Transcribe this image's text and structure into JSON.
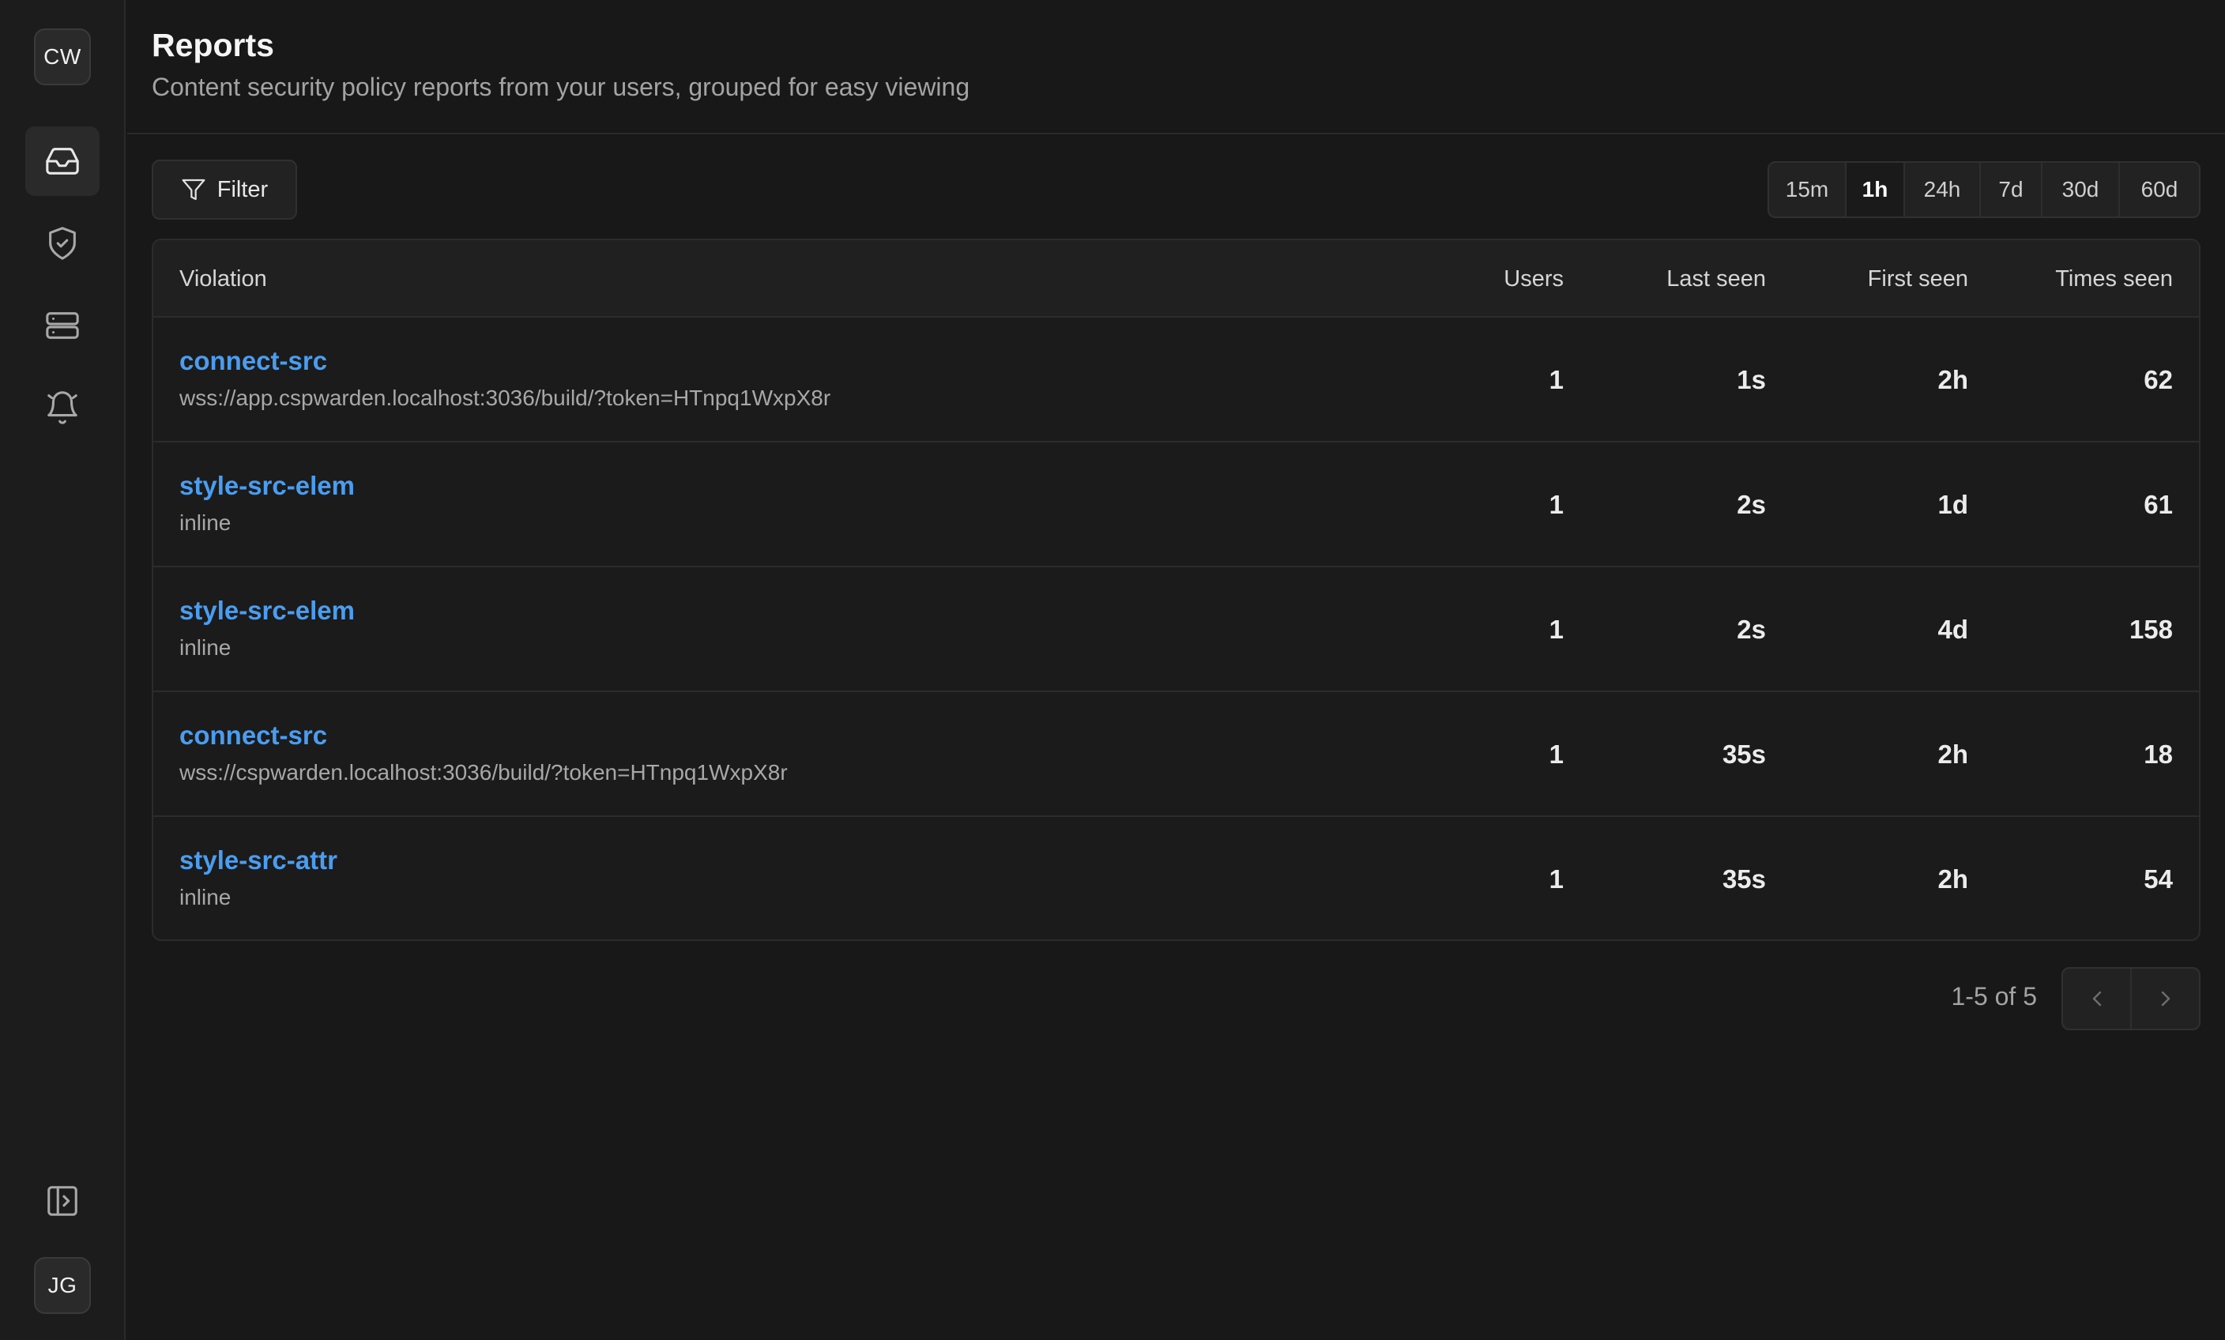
{
  "sidebar": {
    "workspace_badge": "CW",
    "user_badge": "JG",
    "nav": [
      {
        "icon": "inbox-icon",
        "active": true
      },
      {
        "icon": "shield-check-icon",
        "active": false
      },
      {
        "icon": "server-icon",
        "active": false
      },
      {
        "icon": "bell-icon",
        "active": false
      }
    ],
    "collapse_icon": "sidebar-expand-icon"
  },
  "header": {
    "title": "Reports",
    "subtitle": "Content security policy reports from your users, grouped for easy viewing"
  },
  "toolbar": {
    "filter_label": "Filter",
    "ranges": [
      "15m",
      "1h",
      "24h",
      "7d",
      "30d",
      "60d"
    ],
    "active_range": "1h"
  },
  "table": {
    "columns": {
      "violation": "Violation",
      "users": "Users",
      "last_seen": "Last seen",
      "first_seen": "First seen",
      "times_seen": "Times seen"
    },
    "rows": [
      {
        "directive": "connect-src",
        "source": "wss://app.cspwarden.localhost:3036/build/?token=HTnpq1WxpX8r",
        "users": "1",
        "last_seen": "1s",
        "first_seen": "2h",
        "times_seen": "62"
      },
      {
        "directive": "style-src-elem",
        "source": "inline",
        "users": "1",
        "last_seen": "2s",
        "first_seen": "1d",
        "times_seen": "61"
      },
      {
        "directive": "style-src-elem",
        "source": "inline",
        "users": "1",
        "last_seen": "2s",
        "first_seen": "4d",
        "times_seen": "158"
      },
      {
        "directive": "connect-src",
        "source": "wss://cspwarden.localhost:3036/build/?token=HTnpq1WxpX8r",
        "users": "1",
        "last_seen": "35s",
        "first_seen": "2h",
        "times_seen": "18"
      },
      {
        "directive": "style-src-attr",
        "source": "inline",
        "users": "1",
        "last_seen": "35s",
        "first_seen": "2h",
        "times_seen": "54"
      }
    ]
  },
  "pagination": {
    "summary": "1-5 of 5"
  },
  "colors": {
    "background": "#181818",
    "accent_link": "#4a9df0",
    "muted_text": "#a3a3a3"
  }
}
